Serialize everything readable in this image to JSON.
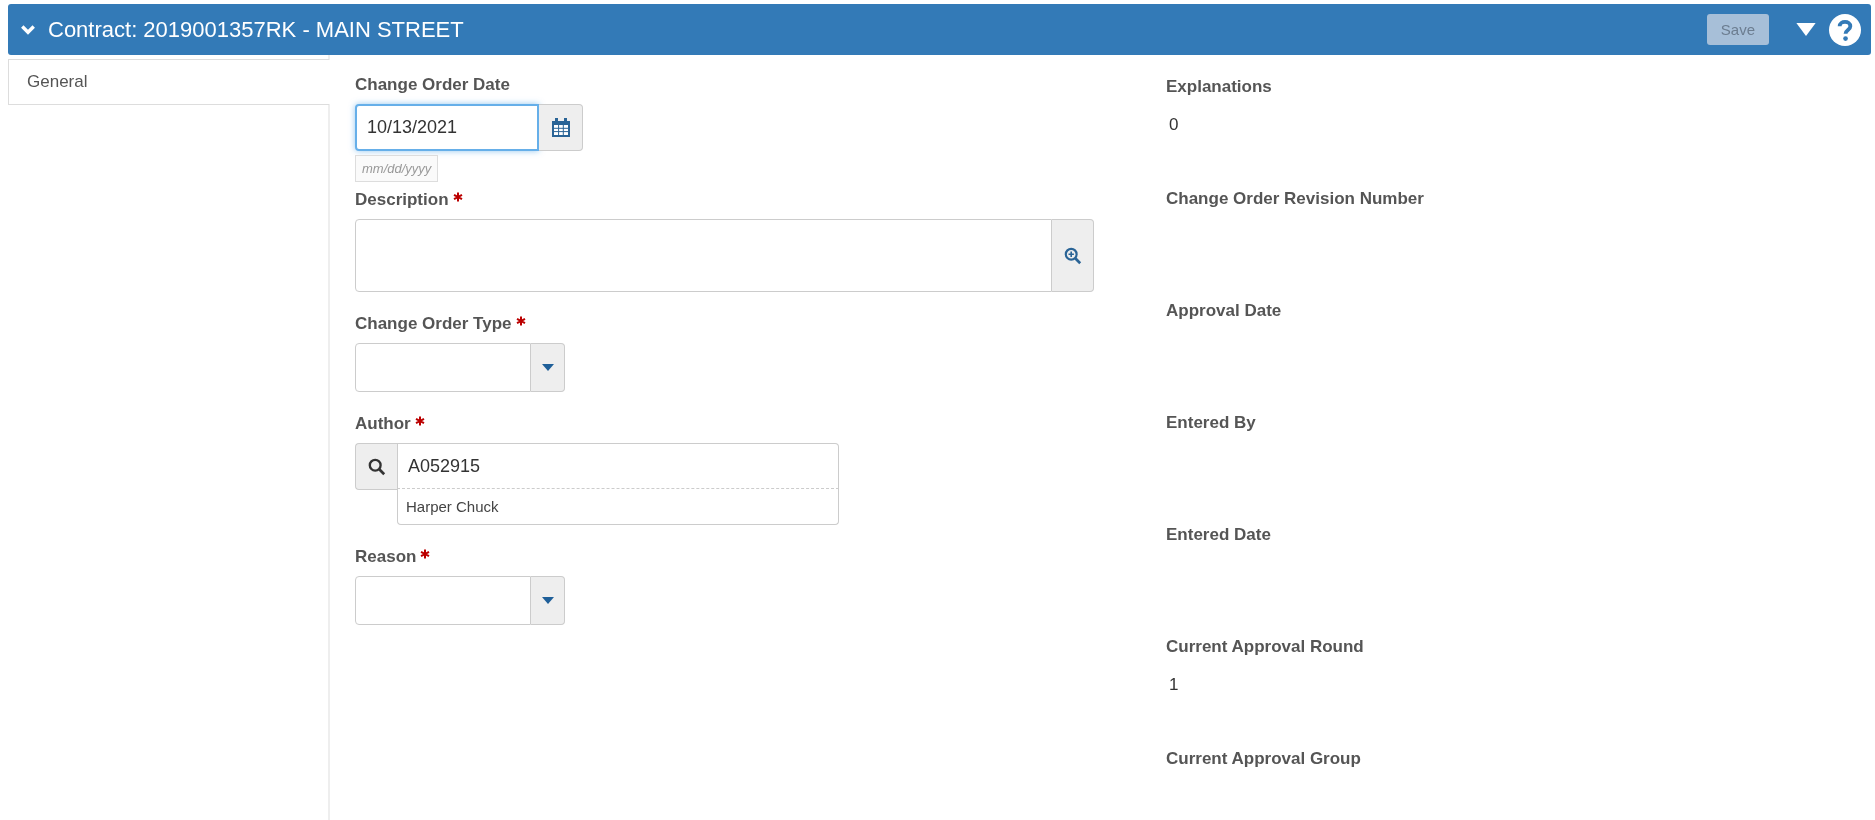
{
  "header": {
    "title": "Contract: 2019001357RK - MAIN STREET",
    "expanded": true,
    "save_button": {
      "label": "Save",
      "disabled": true
    }
  },
  "tabs": [
    {
      "label": "General",
      "selected": true
    }
  ],
  "fields": [
    {
      "kind": "date",
      "label": "Change Order Date",
      "required": false,
      "value": "10/13/2021",
      "focused": true,
      "hint": "mm/dd/yyyy"
    },
    {
      "kind": "textarea",
      "label": "Description",
      "required": true
    },
    {
      "kind": "select",
      "label": "Change Order Type",
      "required": true
    },
    {
      "kind": "lookup",
      "label": "Author",
      "required": true,
      "value": "A052915",
      "description": "Harper Chuck"
    },
    {
      "kind": "select",
      "label": "Reason",
      "required": true
    }
  ],
  "details": [
    {
      "label": "Explanations",
      "value": "0"
    },
    {
      "label": "Change Order Revision Number"
    },
    {
      "label": "Approval Date"
    },
    {
      "label": "Entered By"
    },
    {
      "label": "Entered Date"
    },
    {
      "label": "Current Approval Round",
      "value": "1"
    },
    {
      "label": "Current Approval Group"
    }
  ]
}
